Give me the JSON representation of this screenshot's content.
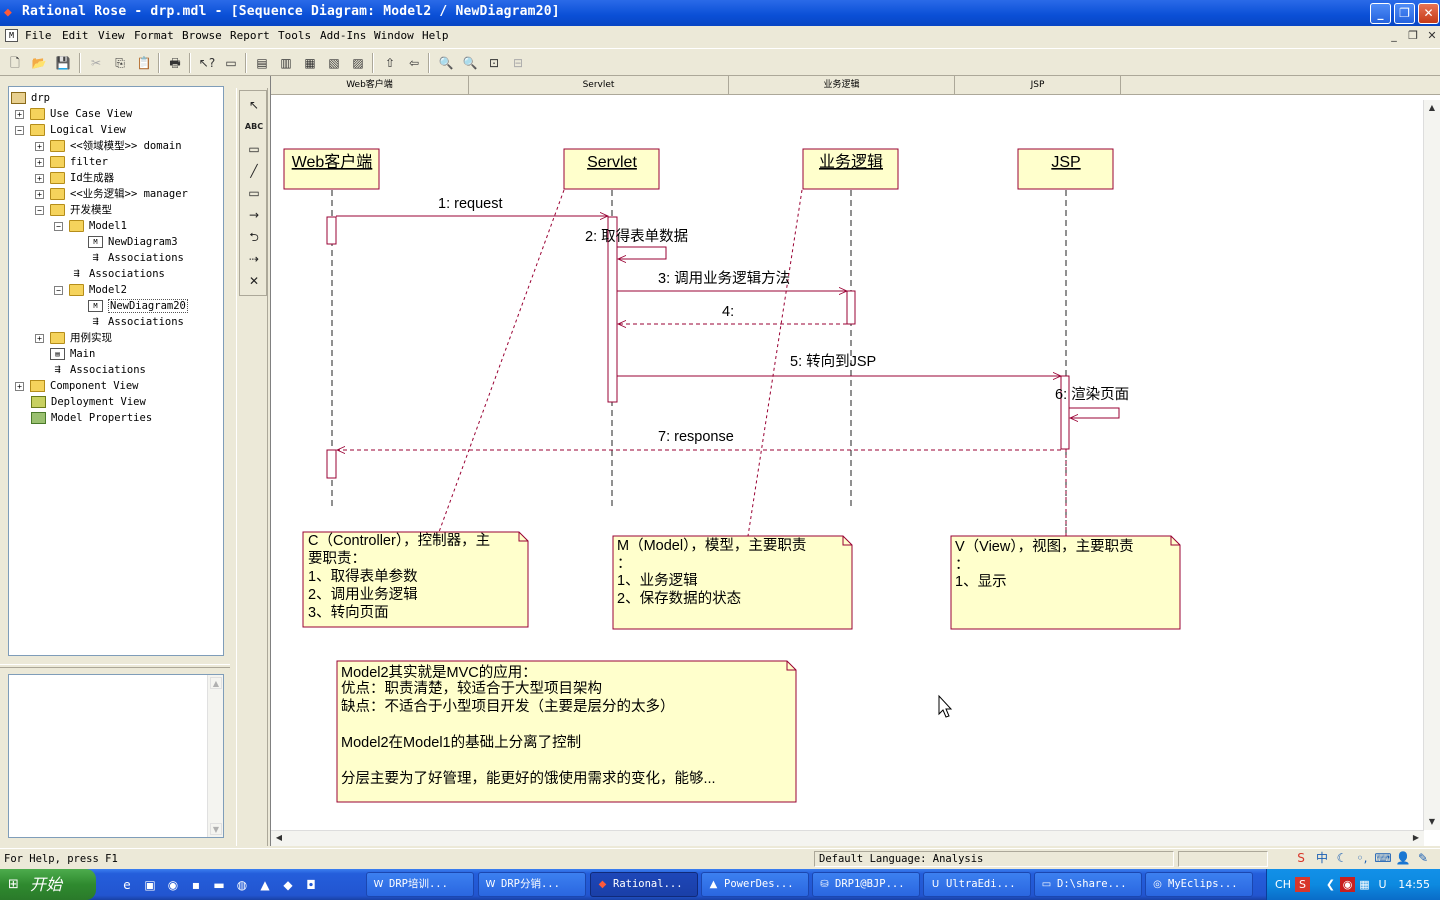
{
  "window": {
    "title": "Rational Rose - drp.mdl - [Sequence Diagram: Model2 / NewDiagram20]",
    "buttons": {
      "minimize": "_",
      "maximize": "❐",
      "close": "✕"
    }
  },
  "menu": [
    "File",
    "Edit",
    "View",
    "Format",
    "Browse",
    "Report",
    "Tools",
    "Add-Ins",
    "Window",
    "Help"
  ],
  "tree": [
    {
      "label": "drp",
      "level": 0,
      "expander": "",
      "icon": "root"
    },
    {
      "label": "Use Case View",
      "level": 1,
      "expander": "+",
      "icon": "folder"
    },
    {
      "label": "Logical View",
      "level": 1,
      "expander": "−",
      "icon": "folder"
    },
    {
      "label": "<<领域模型>> domain",
      "level": 2,
      "expander": "+",
      "icon": "folder"
    },
    {
      "label": "filter",
      "level": 2,
      "expander": "+",
      "icon": "folder"
    },
    {
      "label": "Id生成器",
      "level": 2,
      "expander": "+",
      "icon": "folder"
    },
    {
      "label": "<<业务逻辑>> manager",
      "level": 2,
      "expander": "+",
      "icon": "folder"
    },
    {
      "label": "开发模型",
      "level": 2,
      "expander": "−",
      "icon": "folder"
    },
    {
      "label": "Model1",
      "level": 3,
      "expander": "−",
      "icon": "folder"
    },
    {
      "label": "NewDiagram3",
      "level": 4,
      "expander": "",
      "icon": "diag"
    },
    {
      "label": "Associations",
      "level": 4,
      "expander": "",
      "icon": "assoc"
    },
    {
      "label": "Associations",
      "level": 3,
      "expander": "",
      "icon": "assoc"
    },
    {
      "label": "Model2",
      "level": 3,
      "expander": "−",
      "icon": "folder"
    },
    {
      "label": "NewDiagram20",
      "level": 4,
      "expander": "",
      "icon": "diag",
      "selected": true
    },
    {
      "label": "Associations",
      "level": 4,
      "expander": "",
      "icon": "assoc"
    },
    {
      "label": "用例实现",
      "level": 2,
      "expander": "+",
      "icon": "folder"
    },
    {
      "label": "Main",
      "level": 2,
      "expander": "",
      "icon": "diag"
    },
    {
      "label": "Associations",
      "level": 2,
      "expander": "",
      "icon": "assoc"
    },
    {
      "label": "Component View",
      "level": 1,
      "expander": "+",
      "icon": "comp"
    },
    {
      "label": "Deployment View",
      "level": 1,
      "expander": "",
      "icon": "deploy"
    },
    {
      "label": "Model Properties",
      "level": 1,
      "expander": "",
      "icon": "props"
    }
  ],
  "diagram": {
    "column_headers": [
      "Web客户端",
      "Servlet",
      "业务逻辑",
      "JSP"
    ],
    "objects": [
      "Web客户端",
      "Servlet",
      "业务逻辑",
      "JSP"
    ],
    "messages": [
      "1: request",
      "2: 取得表单数据",
      "3: 调用业务逻辑方法",
      "4:",
      "5: 转向到JSP",
      "6: 渲染页面",
      "7: response"
    ],
    "notes": {
      "controller": [
        "C（Controller），控制器，主",
        "要职责：",
        "1、取得表单参数",
        "2、调用业务逻辑",
        "3、转向页面"
      ],
      "model": [
        "M（Model），模型，主要职责",
        "：",
        "1、业务逻辑",
        "2、保存数据的状态"
      ],
      "view": [
        "V（View），视图，主要职责",
        "：",
        "1、显示"
      ],
      "summary": [
        "Model2其实就是MVC的应用：",
        "优点：职责清楚，较适合于大型项目架构",
        "缺点：不适合于小型项目开发（主要是层分的太多）",
        "",
        "Model2在Model1的基础上分离了控制",
        "",
        "分层主要为了好管理，能更好的饿使用需求的变化，能够..."
      ]
    },
    "colors": {
      "object_fill": "#ffffcc",
      "line": "#990033",
      "note_border": "#990033"
    }
  },
  "status": {
    "help": "For Help, press F1",
    "language": "Default Language: Analysis"
  },
  "taskbar": {
    "start": "开始",
    "tasks": [
      {
        "label": "DRP培训...",
        "icon": "word-icon"
      },
      {
        "label": "DRP分销...",
        "icon": "word-icon"
      },
      {
        "label": "Rational...",
        "icon": "rose-icon",
        "active": true
      },
      {
        "label": "PowerDes...",
        "icon": "powerdesigner-icon"
      },
      {
        "label": "DRP1@BJP...",
        "icon": "database-icon"
      },
      {
        "label": "UltraEdi...",
        "icon": "ultraedit-icon"
      },
      {
        "label": "D:\\share...",
        "icon": "folder-icon"
      },
      {
        "label": "MyEclips...",
        "icon": "eclipse-icon"
      }
    ],
    "tray_lang": "CH",
    "clock": "14:55"
  }
}
